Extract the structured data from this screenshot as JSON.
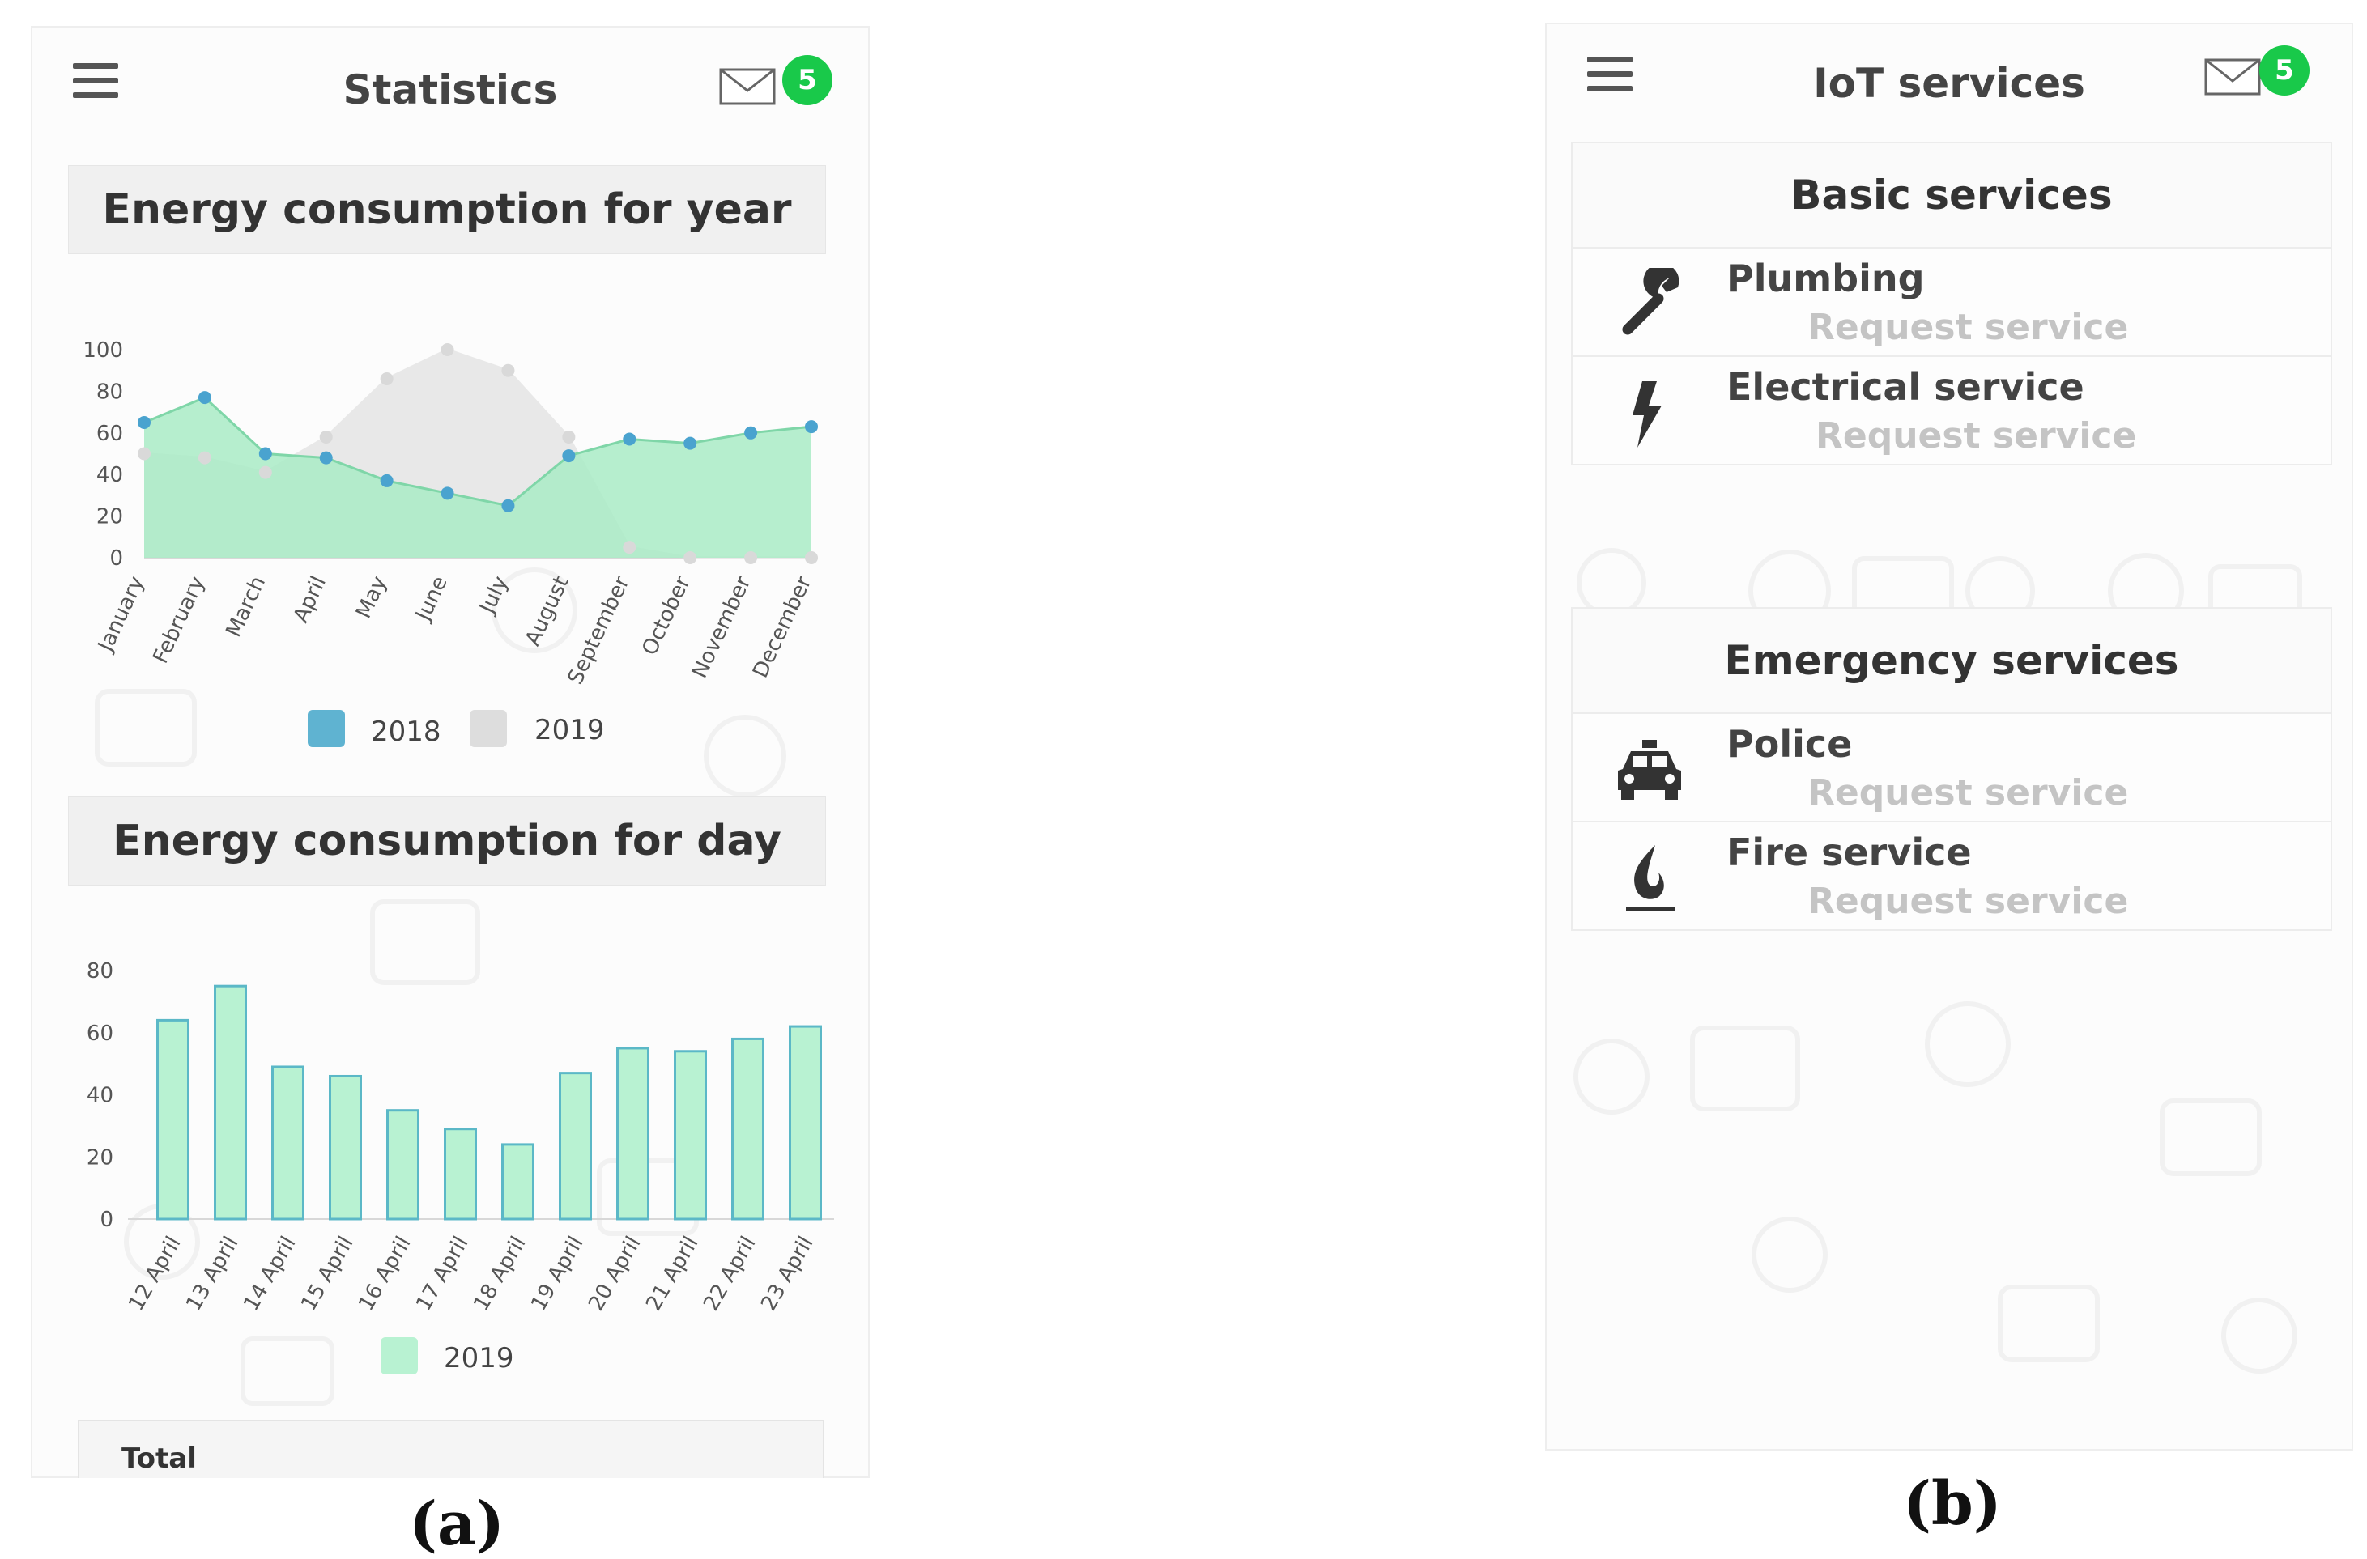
{
  "panel_a": {
    "header": {
      "title": "Statistics",
      "menu_icon": "hamburger-icon",
      "mail_icon": "mail-icon",
      "badge": "5"
    },
    "year_section": {
      "title": "Energy consumption for year"
    },
    "day_section": {
      "title": "Energy consumption for day"
    },
    "total": {
      "label": "Total"
    },
    "caption": "(a)"
  },
  "panel_b": {
    "header": {
      "title": "IoT services",
      "menu_icon": "hamburger-icon",
      "mail_icon": "mail-icon",
      "badge": "5"
    },
    "basic": {
      "title": "Basic services",
      "items": [
        {
          "name": "Plumbing",
          "action": "Request service",
          "icon": "wrench-icon"
        },
        {
          "name": "Electrical service",
          "action": "Request service",
          "icon": "lightning-icon"
        }
      ]
    },
    "emergency": {
      "title": "Emergency services",
      "items": [
        {
          "name": "Police",
          "action": "Request service",
          "icon": "police-car-icon"
        },
        {
          "name": "Fire service",
          "action": "Request service",
          "icon": "flame-icon"
        }
      ]
    },
    "caption": "(b)"
  },
  "colors": {
    "accent_green": "#19c94a",
    "series_2018_fill": "#a9ebc6",
    "series_2018_point": "#4aa3cf",
    "series_2019_fill": "#e2e2e2",
    "bar_fill": "#b8f2d2",
    "bar_stroke": "#5bb8c7"
  },
  "chart_data": [
    {
      "type": "area",
      "categories": [
        "January",
        "February",
        "March",
        "April",
        "May",
        "June",
        "July",
        "August",
        "September",
        "October",
        "November",
        "December"
      ],
      "ylim": [
        0,
        100
      ],
      "yticks": [
        "0",
        "20",
        "40",
        "60",
        "80",
        "100"
      ],
      "series": [
        {
          "name": "2018",
          "values": [
            65,
            77,
            50,
            48,
            37,
            31,
            25,
            49,
            57,
            55,
            60,
            63
          ]
        },
        {
          "name": "2019",
          "values": [
            50,
            48,
            41,
            58,
            86,
            100,
            90,
            58,
            5,
            0,
            0,
            0
          ]
        }
      ],
      "grid": false,
      "legend": "bottom"
    },
    {
      "type": "bar",
      "categories": [
        "12 April",
        "13 April",
        "14 April",
        "15 April",
        "16 April",
        "17 April",
        "18 April",
        "19 April",
        "20 April",
        "21 April",
        "22 April",
        "23 April"
      ],
      "ylim": [
        0,
        80
      ],
      "yticks": [
        "0",
        "20",
        "40",
        "60",
        "80"
      ],
      "series": [
        {
          "name": "2019",
          "values": [
            64,
            75,
            49,
            46,
            35,
            29,
            24,
            47,
            55,
            54,
            58,
            62
          ]
        }
      ],
      "grid": false,
      "legend": "bottom"
    }
  ]
}
